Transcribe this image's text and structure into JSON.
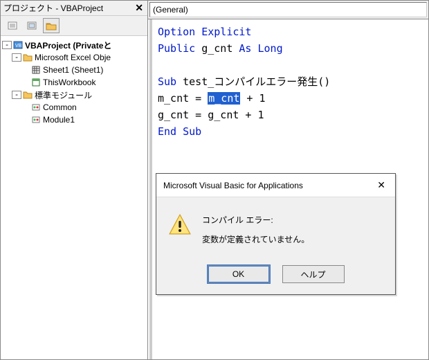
{
  "project_panel": {
    "title": "プロジェクト - VBAProject",
    "tree": {
      "root": "VBAProject (Privateと",
      "folder1": "Microsoft Excel Obje",
      "sheet1": "Sheet1 (Sheet1)",
      "workbook": "ThisWorkbook",
      "folder2": "標準モジュール",
      "module_common": "Common",
      "module1": "Module1"
    }
  },
  "code_panel": {
    "dropdown_general": "(General)"
  },
  "code": {
    "l1a": "Option Explicit",
    "l2a": "Public",
    "l2b": " g_cnt ",
    "l2c": "As Long",
    "l4a": "Sub",
    "l4b": " test_コンパイルエラー発生()",
    "l5a": "    m_cnt = ",
    "l5sel": "m_cnt",
    "l5b": " + 1",
    "l6": "    g_cnt = g_cnt + 1",
    "l7": "End Sub"
  },
  "dialog": {
    "title": "Microsoft Visual Basic for Applications",
    "msg1": "コンパイル エラー:",
    "msg2": "変数が定義されていません。",
    "ok": "OK",
    "help": "ヘルプ"
  }
}
